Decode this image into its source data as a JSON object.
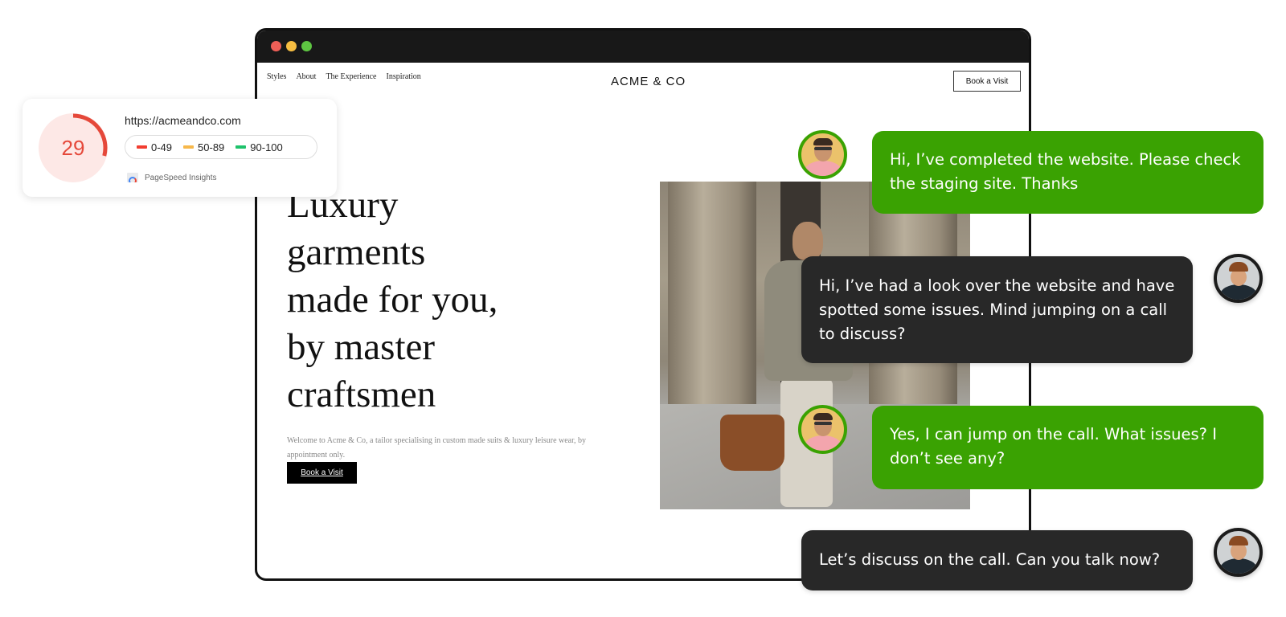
{
  "browser": {
    "window_controls": [
      "close",
      "minimize",
      "maximize"
    ],
    "site": {
      "nav": [
        "Styles",
        "About",
        "The Experience",
        "Inspiration"
      ],
      "logo": "ACME & CO",
      "nav_cta": "Book a Visit",
      "hero": {
        "title_lines": [
          "Luxury",
          "garments",
          "made for you,",
          "by master",
          "craftsmen"
        ],
        "description": "Welcome to Acme & Co, a tailor specialising in custom made suits & luxury leisure wear, by appointment only.",
        "cta": "Book a Visit",
        "image_alt": "man in trench jacket carrying leather bag"
      }
    }
  },
  "pagespeed": {
    "score": "29",
    "score_fraction": 0.29,
    "url": "https://acmeandco.com",
    "legend": [
      {
        "label": "0-49",
        "color": "#f23d30"
      },
      {
        "label": "50-89",
        "color": "#f7b84b"
      },
      {
        "label": "90-100",
        "color": "#1ec26b"
      }
    ],
    "brand": "PageSpeed Insights",
    "score_color": "#e5483a",
    "gauge_bg": "#fde8e6"
  },
  "chat": {
    "colors": {
      "designer": "#3aa202",
      "client": "#282828"
    },
    "messages": [
      {
        "sender": "designer",
        "text": "Hi, I’ve completed the website. Please check the staging site. Thanks"
      },
      {
        "sender": "client",
        "text": "Hi, I’ve had a look over the website and have spotted some issues. Mind jumping on a call to discuss?"
      },
      {
        "sender": "designer",
        "text": "Yes, I can jump on the call. What issues? I don’t see any?"
      },
      {
        "sender": "client",
        "text": "Let’s discuss on the call. Can you talk now?"
      }
    ]
  }
}
